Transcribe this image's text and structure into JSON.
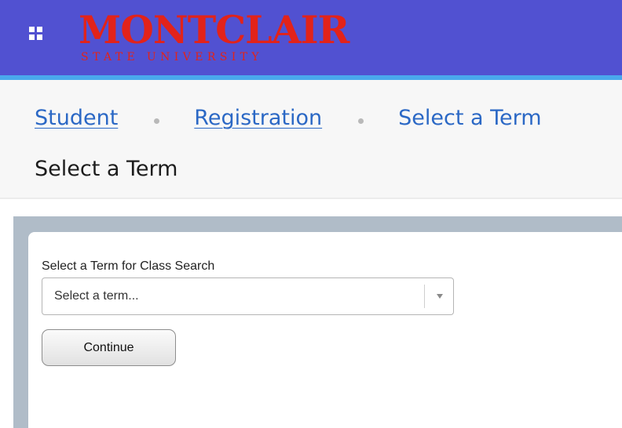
{
  "header": {
    "apps_icon": "apps-grid-icon",
    "logo": {
      "main": "MONTCLAIR",
      "sub": "STATE UNIVERSITY"
    },
    "colors": {
      "bar": "#5151d1",
      "underline": "#4aa8ec",
      "logo": "#e2231a"
    }
  },
  "breadcrumb": {
    "items": [
      "Student",
      "Registration"
    ],
    "current": "Select a Term"
  },
  "page": {
    "title": "Select a Term"
  },
  "form": {
    "term_label": "Select a Term for Class Search",
    "term_placeholder": "Select a term...",
    "dropdown_icon": "chevron-down-icon",
    "continue_label": "Continue"
  }
}
